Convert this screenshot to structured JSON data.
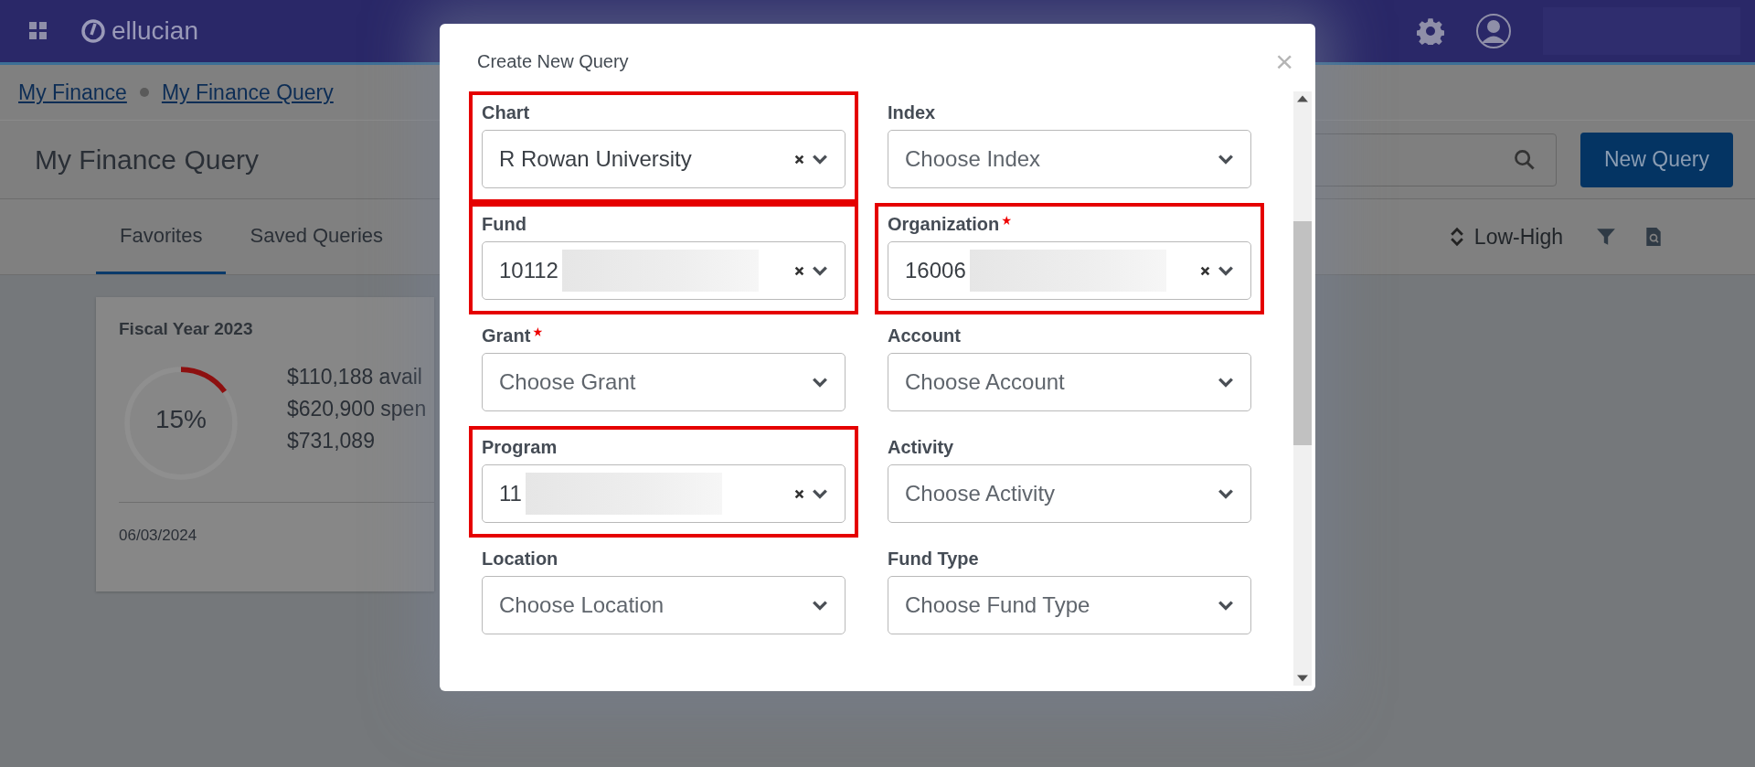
{
  "header": {
    "logo": "ellucian"
  },
  "breadcrumbs": [
    "My Finance",
    "My Finance Query"
  ],
  "page_title": "My Finance Query",
  "new_query_button": "New Query",
  "tabs": [
    {
      "label": "Favorites",
      "selected": true
    },
    {
      "label": "Saved Queries",
      "selected": false
    }
  ],
  "sort": {
    "label": "Low-High"
  },
  "card": {
    "title": "Fiscal Year 2023",
    "level": 0.15,
    "percent": "15%",
    "lines": [
      "$110,188 avail",
      "$620,900 spen",
      "$731,089"
    ],
    "date": "06/03/2024"
  },
  "modal": {
    "title": "Create New Query",
    "close": "×",
    "fields": [
      {
        "label": "Chart",
        "required": false,
        "value": "R Rowan University",
        "redacted": false,
        "highlighted": true
      },
      {
        "label": "Index",
        "required": false,
        "placeholder": "Choose Index",
        "highlighted": false
      },
      {
        "label": "Fund",
        "required": false,
        "value": "10112",
        "redacted": true,
        "highlighted": true
      },
      {
        "label": "Organization",
        "required": true,
        "value": "16006",
        "redacted": true,
        "highlighted": true
      },
      {
        "label": "Grant",
        "required": true,
        "placeholder": "Choose Grant",
        "highlighted": false
      },
      {
        "label": "Account",
        "required": false,
        "placeholder": "Choose Account",
        "highlighted": false
      },
      {
        "label": "Program",
        "required": false,
        "value": "11",
        "redacted": true,
        "highlighted": true
      },
      {
        "label": "Activity",
        "required": false,
        "placeholder": "Choose Activity",
        "highlighted": false
      },
      {
        "label": "Location",
        "required": false,
        "placeholder": "Choose Location",
        "highlighted": false
      },
      {
        "label": "Fund Type",
        "required": false,
        "placeholder": "Choose Fund Type",
        "highlighted": false
      }
    ]
  }
}
